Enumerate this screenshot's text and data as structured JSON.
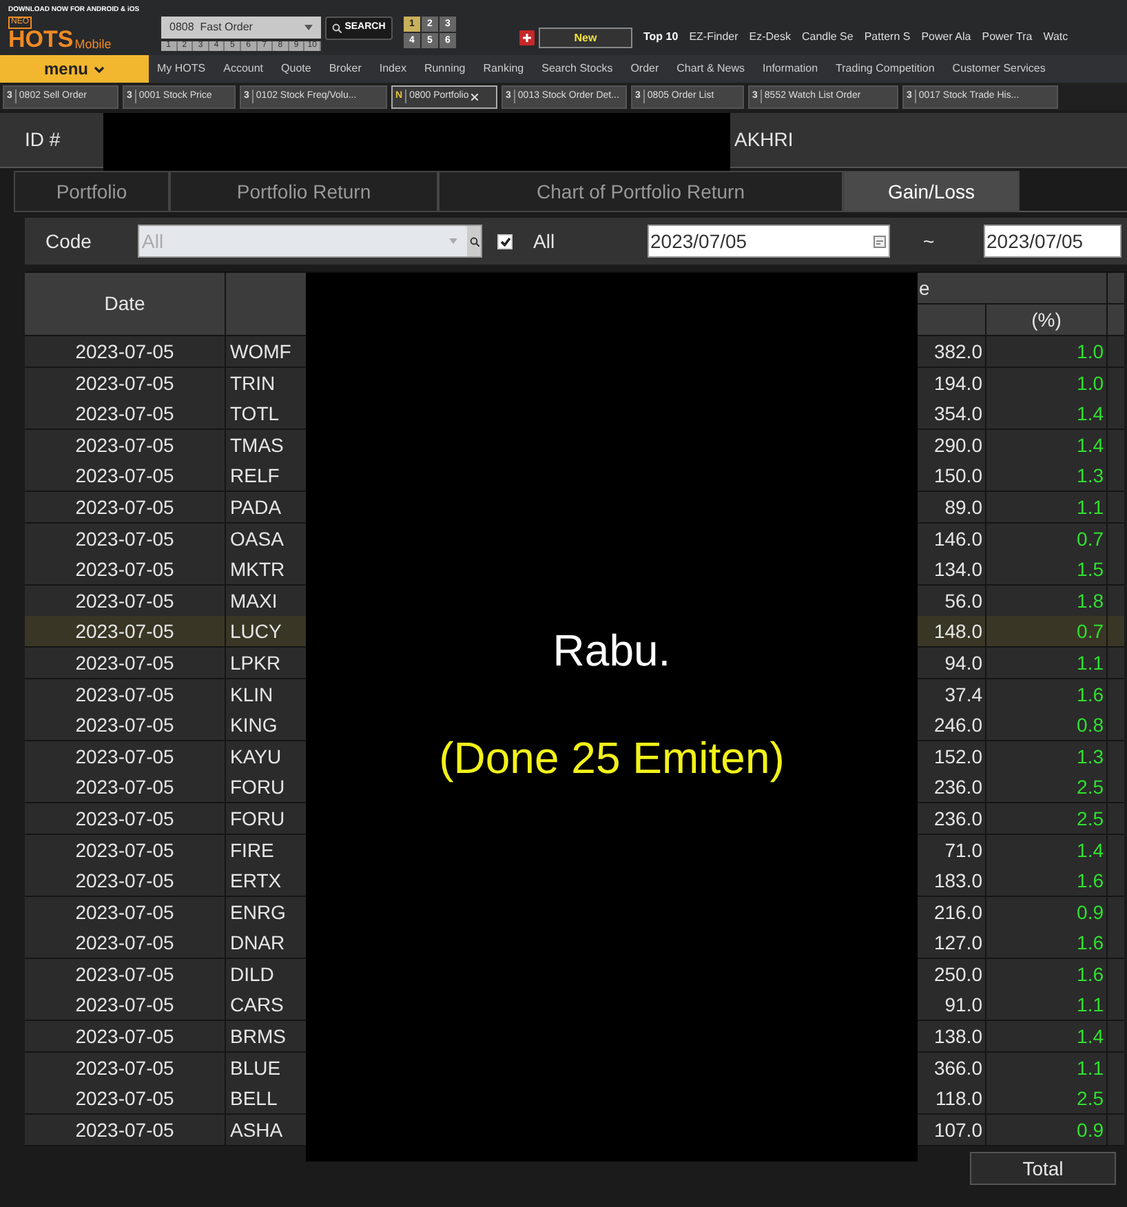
{
  "app": {
    "promo": "DOWNLOAD NOW FOR ANDROID & iOS",
    "logo_top": "NEO",
    "logo": "HOTS",
    "logo_sub": "Mobile",
    "menu": "menu"
  },
  "screen_combo": {
    "value": "0808  Fast Order"
  },
  "search_button": "SEARCH",
  "slots": [
    "1",
    "2",
    "3",
    "4",
    "5",
    "6",
    "7",
    "8",
    "9",
    "10"
  ],
  "layouts": [
    {
      "label": "1",
      "selected": true
    },
    {
      "label": "2",
      "selected": false
    },
    {
      "label": "3",
      "selected": false
    },
    {
      "label": "4",
      "selected": false
    },
    {
      "label": "5",
      "selected": false
    },
    {
      "label": "6",
      "selected": false
    }
  ],
  "new_button": "New",
  "quick_links": [
    "Top 10",
    "EZ-Finder",
    "Ez-Desk",
    "Candle Se",
    "Pattern S",
    "Power Ala",
    "Power Tra",
    "Watc"
  ],
  "main_menu": [
    "My HOTS",
    "Account",
    "Quote",
    "Broker",
    "Index",
    "Running",
    "Ranking",
    "Search Stocks",
    "Order",
    "Chart & News",
    "Information",
    "Trading Competition",
    "Customer Services"
  ],
  "windows": [
    {
      "badge": "3",
      "label": "0802 Sell Order",
      "selected": false
    },
    {
      "badge": "3",
      "label": "0001 Stock Price",
      "selected": false
    },
    {
      "badge": "3",
      "label": "0102 Stock Freq/Volu...",
      "selected": false
    },
    {
      "badge": "N",
      "label": "0800 Portfolio",
      "selected": true,
      "closable": true
    },
    {
      "badge": "3",
      "label": "0013 Stock Order Det...",
      "selected": false
    },
    {
      "badge": "3",
      "label": "0805 Order  List",
      "selected": false
    },
    {
      "badge": "3",
      "label": "8552 Watch List Order",
      "selected": false
    },
    {
      "badge": "3",
      "label": "0017 Stock Trade His...",
      "selected": false
    }
  ],
  "account": {
    "label": "ID #",
    "name": "AKHRI"
  },
  "tabs": [
    {
      "label": "Portfolio",
      "selected": false
    },
    {
      "label": "Portfolio Return",
      "selected": false
    },
    {
      "label": "Chart of Portfolio Return",
      "selected": false
    },
    {
      "label": "Gain/Loss",
      "selected": true
    }
  ],
  "filter": {
    "label": "Code",
    "code": {
      "placeholder": "All"
    },
    "all_checked": true,
    "all_label": "All",
    "date_from": "2023/07/05",
    "separator": "~",
    "date_to": "2023/07/05"
  },
  "table": {
    "columns": [
      "Date",
      "",
      "e",
      "(%)"
    ],
    "rows": [
      {
        "date": "2023-07-05",
        "code": "WOMF",
        "column_3": "382.0",
        "percent": "1.0",
        "selected": false
      },
      {
        "date": "2023-07-05",
        "code": "TRIN",
        "column_3": "194.0",
        "percent": "1.0",
        "selected": false
      },
      {
        "date": "2023-07-05",
        "code": "TOTL",
        "column_3": "354.0",
        "percent": "1.4",
        "selected": false
      },
      {
        "date": "2023-07-05",
        "code": "TMAS",
        "column_3": "290.0",
        "percent": "1.4",
        "selected": false
      },
      {
        "date": "2023-07-05",
        "code": "RELF",
        "column_3": "150.0",
        "percent": "1.3",
        "selected": false
      },
      {
        "date": "2023-07-05",
        "code": "PADA",
        "column_3": "89.0",
        "percent": "1.1",
        "selected": false
      },
      {
        "date": "2023-07-05",
        "code": "OASA",
        "column_3": "146.0",
        "percent": "0.7",
        "selected": false
      },
      {
        "date": "2023-07-05",
        "code": "MKTR",
        "column_3": "134.0",
        "percent": "1.5",
        "selected": false
      },
      {
        "date": "2023-07-05",
        "code": "MAXI",
        "column_3": "56.0",
        "percent": "1.8",
        "selected": false
      },
      {
        "date": "2023-07-05",
        "code": "LUCY",
        "column_3": "148.0",
        "percent": "0.7",
        "selected": true
      },
      {
        "date": "2023-07-05",
        "code": "LPKR",
        "column_3": "94.0",
        "percent": "1.1",
        "selected": false
      },
      {
        "date": "2023-07-05",
        "code": "KLIN",
        "column_3": "37.4",
        "percent": "1.6",
        "selected": false
      },
      {
        "date": "2023-07-05",
        "code": "KING",
        "column_3": "246.0",
        "percent": "0.8",
        "selected": false
      },
      {
        "date": "2023-07-05",
        "code": "KAYU",
        "column_3": "152.0",
        "percent": "1.3",
        "selected": false
      },
      {
        "date": "2023-07-05",
        "code": "FORU",
        "column_3": "236.0",
        "percent": "2.5",
        "selected": false
      },
      {
        "date": "2023-07-05",
        "code": "FORU",
        "column_3": "236.0",
        "percent": "2.5",
        "selected": false
      },
      {
        "date": "2023-07-05",
        "code": "FIRE",
        "column_3": "71.0",
        "percent": "1.4",
        "selected": false
      },
      {
        "date": "2023-07-05",
        "code": "ERTX",
        "column_3": "183.0",
        "percent": "1.6",
        "selected": false
      },
      {
        "date": "2023-07-05",
        "code": "ENRG",
        "column_3": "216.0",
        "percent": "0.9",
        "selected": false
      },
      {
        "date": "2023-07-05",
        "code": "DNAR",
        "column_3": "127.0",
        "percent": "1.6",
        "selected": false
      },
      {
        "date": "2023-07-05",
        "code": "DILD",
        "column_3": "250.0",
        "percent": "1.6",
        "selected": false
      },
      {
        "date": "2023-07-05",
        "code": "CARS",
        "column_3": "91.0",
        "percent": "1.1",
        "selected": false
      },
      {
        "date": "2023-07-05",
        "code": "BRMS",
        "column_3": "138.0",
        "percent": "1.4",
        "selected": false
      },
      {
        "date": "2023-07-05",
        "code": "BLUE",
        "column_3": "366.0",
        "percent": "1.1",
        "selected": false
      },
      {
        "date": "2023-07-05",
        "code": "BELL",
        "column_3": "118.0",
        "percent": "2.5",
        "selected": false
      },
      {
        "date": "2023-07-05",
        "code": "ASHA",
        "column_3": "107.0",
        "percent": "0.9",
        "selected": false
      }
    ]
  },
  "total_button": "Total",
  "overlay": {
    "lines": [
      "Rabu.",
      "(Done 25 Emiten)"
    ]
  }
}
